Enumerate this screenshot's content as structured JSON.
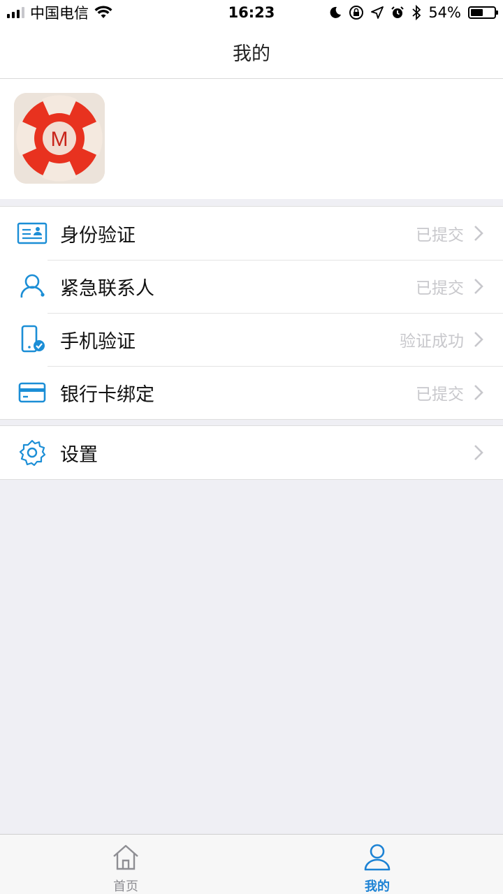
{
  "status_bar": {
    "carrier": "中国电信",
    "time": "16:23",
    "battery_percent": "54%",
    "battery_level": 0.54,
    "icons": [
      "signal-icon",
      "wifi-icon",
      "moon-icon",
      "rotation-lock-icon",
      "location-icon",
      "alarm-icon",
      "bluetooth-icon",
      "battery-icon"
    ]
  },
  "nav": {
    "title": "我的"
  },
  "profile": {
    "avatar_letter": "M",
    "avatar_colors": {
      "ring": "#e8321f",
      "stripe": "#f4e9df",
      "center": "#f2ddd2"
    }
  },
  "menu": {
    "items": [
      {
        "label": "身份验证",
        "status": "已提交",
        "icon": "id-card-icon"
      },
      {
        "label": "紧急联系人",
        "status": "已提交",
        "icon": "contact-person-icon"
      },
      {
        "label": "手机验证",
        "status": "验证成功",
        "icon": "phone-verified-icon"
      },
      {
        "label": "银行卡绑定",
        "status": "已提交",
        "icon": "bank-card-icon"
      }
    ],
    "settings": {
      "label": "设置",
      "icon": "gear-icon"
    }
  },
  "tabbar": {
    "home_label": "首页",
    "mine_label": "我的",
    "active": "mine"
  },
  "colors": {
    "accent": "#1c82d4",
    "icon_blue": "#1b8ed6",
    "background": "#efeff4",
    "status_text": "#c8c8cc"
  }
}
